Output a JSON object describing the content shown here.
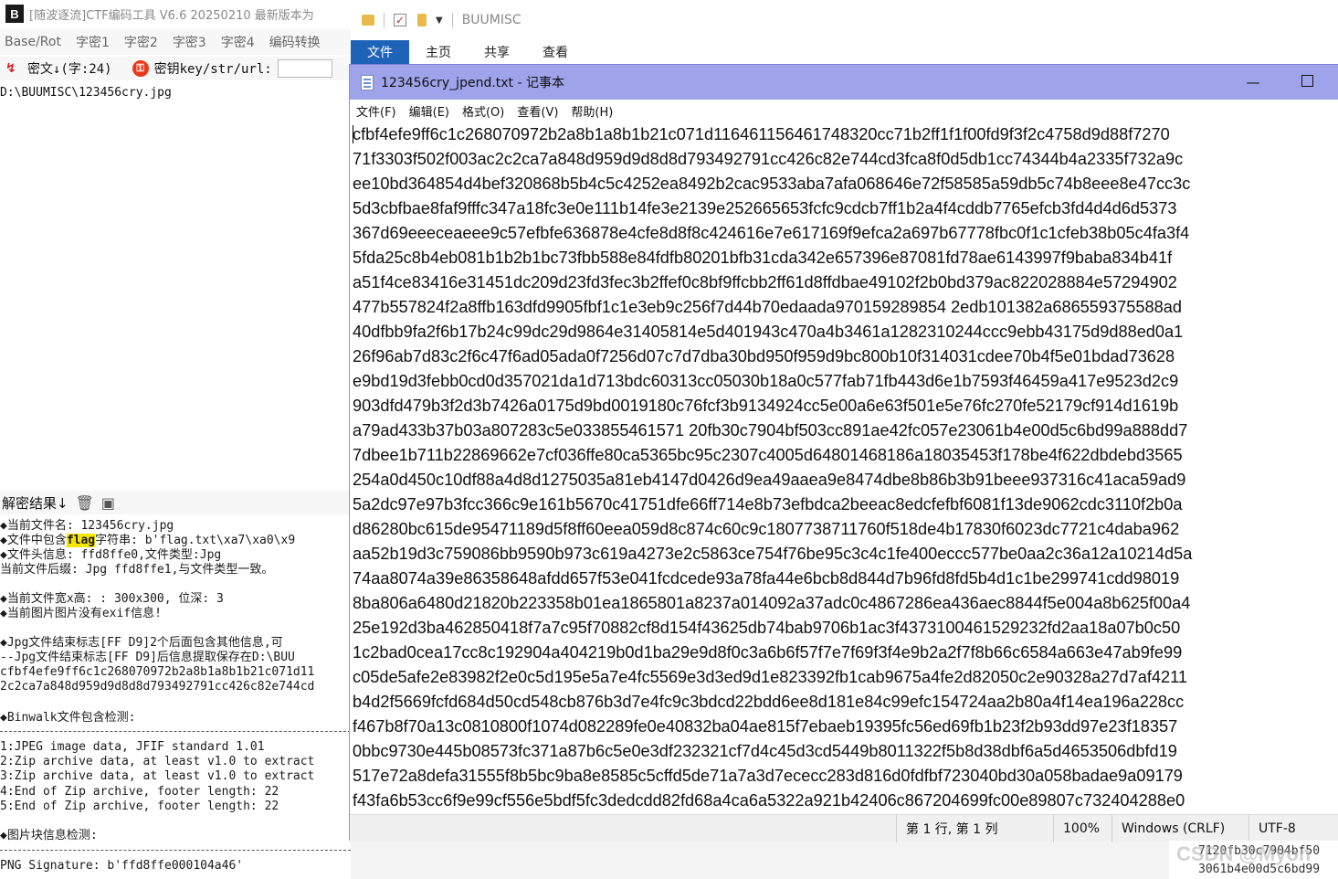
{
  "ctf_tool": {
    "title": "[随波逐流]CTF编码工具 V6.6 20250210    最新版本为",
    "logo": "B",
    "menu": [
      "Base/Rot",
      "字密1",
      "字密2",
      "字密3",
      "字密4",
      "编码转换"
    ],
    "cipher_label": "密文↓(字:24)",
    "key_label": "密钥key/str/url:",
    "cipher_text": "D:\\BUUMISC\\123456cry.jpg",
    "result_label": "解密结果↓",
    "result_lines": [
      "◆当前文件名: 123456cry.jpg",
      "◆文件中包含",
      "flag",
      "字符串: b'flag.txt\\xa7\\xa0\\x9",
      "◆文件头信息: ffd8ffe0,文件类型:Jpg",
      "当前文件后缀: Jpg  ffd8ffe1,与文件类型一致。",
      "◆当前文件宽x高: : 300x300, 位深: 3",
      "◆当前图片图片没有exif信息!",
      "◆Jpg文件结束标志[FF D9]2个后面包含其他信息,可",
      "--Jpg文件结束标志[FF D9]后信息提取保存在D:\\BUU",
      "cfbf4efe9ff6c1c268070972b2a8b1a8b1b21c071d11",
      "2c2ca7a848d959d9d8d8d793492791cc426c82e744cd",
      "◆Binwalk文件包含检测:",
      "1:JPEG image data, JFIF standard 1.01",
      "2:Zip archive data, at least v1.0 to extract",
      "3:Zip archive data, at least v1.0 to extract",
      "4:End of Zip archive, footer length: 22",
      "5:End of Zip archive, footer length: 22",
      "◆图片块信息检测:",
      "PNG Signature: b'ffd8ffe000104a46'"
    ]
  },
  "explorer": {
    "title": "BUUMISC",
    "tabs": [
      "文件",
      "主页",
      "共享",
      "查看"
    ]
  },
  "notepad": {
    "title": "123456cry_jpend.txt - 记事本",
    "minimize": "—",
    "menu": [
      "文件(F)",
      "编辑(E)",
      "格式(O)",
      "查看(V)",
      "帮助(H)"
    ],
    "lines": [
      "cfbf4efe9ff6c1c268070972b2a8b1a8b1b21c071d116461156461748320cc71b2ff1f1f00fd9f3f2c4758d9d88f7270",
      "71f3303f502f003ac2c2ca7a848d959d9d8d8d793492791cc426c82e744cd3fca8f0d5db1cc74344b4a2335f732a9c",
      "ee10bd364854d4bef320868b5b4c5c4252ea8492b2cac9533aba7afa068646e72f58585a59db5c74b8eee8e47cc3c",
      "5d3cbfbae8faf9fffc347a18fc3e0e111b14fe3e2139e252665653fcfc9cdcb7ff1b2a4f4cddb7765efcb3fd4d4d6d5373",
      "367d69eeeceaeee9c57efbfe636878e4cfe8d8f8c424616e7e617169f9efca2a697b67778fbc0f1c1cfeb38b05c4fa3f4",
      "5fda25c8b4eb081b1b2b1bc73fbb588e84fdfb80201bfb31cda342e657396e87081fd78ae6143997f9baba834b41f",
      "a51f4ce83416e31451dc209d23fd3fec3b2ffef0c8bf9ffcbb2ff61d8ffdbae49102f2b0bd379ac822028884e57294902",
      "477b557824f2a8ffb163dfd9905fbf1c1e3eb9c256f7d44b70edaada970159289854 2edb101382a686559375588ad",
      "40dfbb9fa2f6b17b24c99dc29d9864e31405814e5d401943c470a4b3461a1282310244ccc9ebb43175d9d88ed0a1",
      "26f96ab7d83c2f6c47f6ad05ada0f7256d07c7d7dba30bd950f959d9bc800b10f314031cdee70b4f5e01bdad73628",
      "e9bd19d3febb0cd0d357021da1d713bdc60313cc05030b18a0c577fab71fb443d6e1b7593f46459a417e9523d2c9",
      "903dfd479b3f2d3b7426a0175d9bd0019180c76fcf3b9134924cc5e00a6e63f501e5e76fc270fe52179cf914d1619b",
      "a79ad433b37b03a807283c5e033855461571 20fb30c7904bf503cc891ae42fc057e23061b4e00d5c6bd99a888dd7",
      "7dbee1b711b22869662e7cf036ffe80ca5365bc95c2307c4005d64801468186a18035453f178be4f622dbdebd3565",
      "254a0d450c10df88a4d8d1275035a81eb4147d0426d9ea49aaea9e8474dbe8b86b3b91beee937316c41aca59ad9",
      "5a2dc97e97b3fcc366c9e161b5670c41751dfe66ff714e8b73efbdca2beeac8edcfefbf6081f13de9062cdc3110f2b0a",
      "d86280bc615de95471189d5f8ff60eea059d8c874c60c9c1807738711760f518de4b17830f6023dc7721c4daba962",
      "aa52b19d3c759086bb9590b973c619a4273e2c5863ce754f76be95c3c4c1fe400eccc577be0aa2c36a12a10214d5a",
      "74aa8074a39e86358648afdd657f53e041fcdcede93a78fa44e6bcb8d844d7b96fd8fd5b4d1c1be299741cdd98019",
      "8ba806a6480d21820b223358b01ea1865801a8237a014092a37adc0c4867286ea436aec8844f5e004a8b625f00a4",
      "25e192d3ba462850418f7a7c95f70882cf8d154f43625db74bab9706b1ac3f4373100461529232fd2aa18a07b0c50",
      "1c2bad0cea17cc8c192904a404219b0d1ba29e9d8f0c3a6b6f57f7e7f69f3f4e9b2a2f7f8b66c6584a663e47ab9fe99",
      "c05de5afe2e83982f2e0c5d195e5a7e4fc5569e3d3ed9d1e823392fb1cab9675a4fe2d82050c2e90328a27d7af4211",
      "b4d2f5669fcfd684d50cd548cb876b3d7e4fc9c3bdcd22bdd6ee8d181e84c99efc154724aa2b80a4f14ea196a228cc",
      "f467b8f70a13c0810800f1074d082289fe0e40832ba04ae815f7ebaeb19395fc56ed69fb1b23f2b93dd97e23f18357",
      "0bbc9730e445b08573fc371a87b6c5e0e3df232321cf7d4c45d3cd5449b8011322f5b8d38dbf6a5d4653506dbfd19",
      "517e72a8defa31555f8b5bc9ba8e8585c5cffd5de71a7a3d7ececc283d816d0fdfbf723040bd30a058badae9a09179",
      "f43fa6b53cc6f9e99cf556e5bdf5fc3dedcdd82fd68a4ca6a5322a921b42406c867204699fc00e89807c732404288e0"
    ],
    "status": {
      "position": "第 1 行, 第 1 列",
      "zoom": "100%",
      "eol": "Windows (CRLF)",
      "encoding": "UTF-8"
    }
  },
  "peek": {
    "line1": "7120fb30c7904bf50",
    "line2": "3061b4e00d5c6bd99",
    "watermark": "CSDN @Myon"
  }
}
